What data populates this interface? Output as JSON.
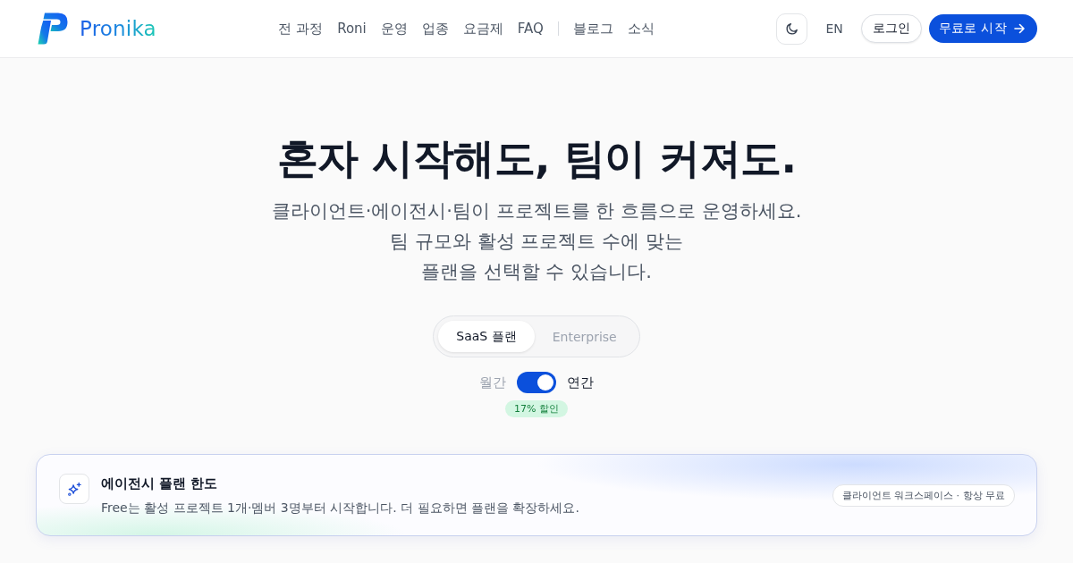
{
  "header": {
    "brand": "Pronika",
    "nav_groups": [
      {
        "items": [
          {
            "label": "전 과정"
          },
          {
            "label": "Roni"
          },
          {
            "label": "운영"
          },
          {
            "label": "업종"
          },
          {
            "label": "요금제"
          },
          {
            "label": "FAQ"
          }
        ]
      },
      {
        "items": [
          {
            "label": "블로그"
          },
          {
            "label": "소식"
          }
        ]
      }
    ],
    "language": "EN",
    "login_button": "로그인",
    "cta_button": "무료로 시작"
  },
  "hero": {
    "title": "혼자 시작해도, 팀이 커져도.",
    "subtitle_lines": [
      "클라이언트·에이전시·팀이 프로젝트를 한 흐름으로 운영하세요.",
      "팀 규모와 활성 프로젝트 수에 맞는",
      "플랜을 선택할 수 있습니다."
    ]
  },
  "plan_tabs": [
    {
      "label": "SaaS 플랜",
      "selected": true
    },
    {
      "label": "Enterprise",
      "selected": false
    }
  ],
  "billing": {
    "monthly_label": "월간",
    "annual_label": "연간",
    "annual": true,
    "discount_badge": "17% 할인"
  },
  "notice_card": {
    "title": "에이전시 플랜 한도",
    "description": "Free는 활성 프로젝트 1개·멤버 3명부터 시작합니다. 더 필요하면 플랜을 확장하세요.",
    "tag": "클라이언트 워크스페이스 · 항상 무료"
  }
}
